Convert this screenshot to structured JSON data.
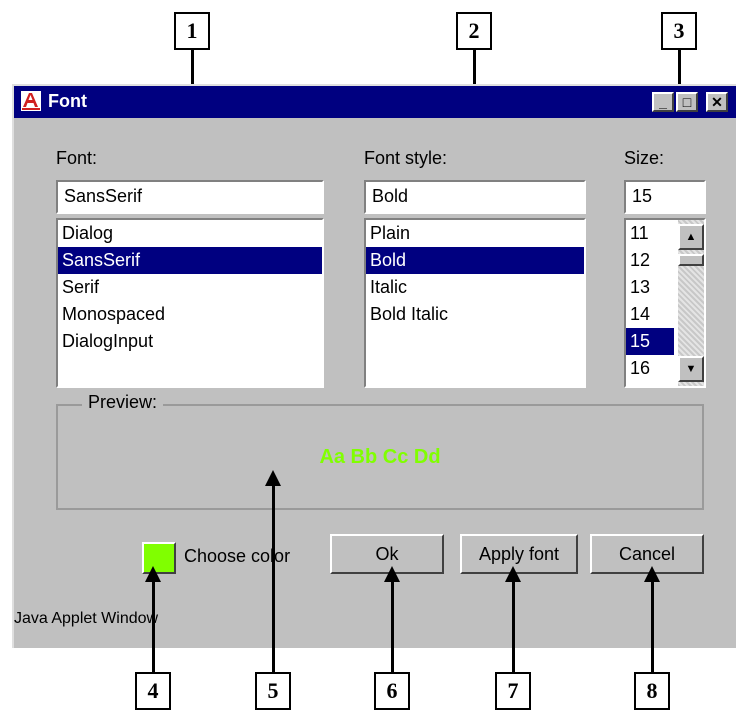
{
  "callouts": [
    "1",
    "2",
    "3",
    "4",
    "5",
    "6",
    "7",
    "8"
  ],
  "window": {
    "title": "Font",
    "minimize_glyph": "_",
    "maximize_glyph": "□",
    "close_glyph": "✕"
  },
  "font": {
    "label": "Font:",
    "value": "SansSerif",
    "options": [
      "Dialog",
      "SansSerif",
      "Serif",
      "Monospaced",
      "DialogInput"
    ],
    "selected_index": 1
  },
  "font_style": {
    "label": "Font style:",
    "value": "Bold",
    "options": [
      "Plain",
      "Bold",
      "Italic",
      "Bold Italic"
    ],
    "selected_index": 1
  },
  "size": {
    "label": "Size:",
    "value": "15",
    "options": [
      "11",
      "12",
      "13",
      "14",
      "15",
      "16"
    ],
    "selected_index": 4
  },
  "preview": {
    "legend": "Preview:",
    "sample": "Aa Bb Cc Dd",
    "color": "#80ff00"
  },
  "controls": {
    "choose_color": "Choose color",
    "ok": "Ok",
    "apply": "Apply font",
    "cancel": "Cancel"
  },
  "status": "Java Applet Window",
  "icons": {
    "app": "font-app-icon",
    "scroll_up": "scroll-up-arrow-icon",
    "scroll_down": "scroll-down-arrow-icon"
  }
}
